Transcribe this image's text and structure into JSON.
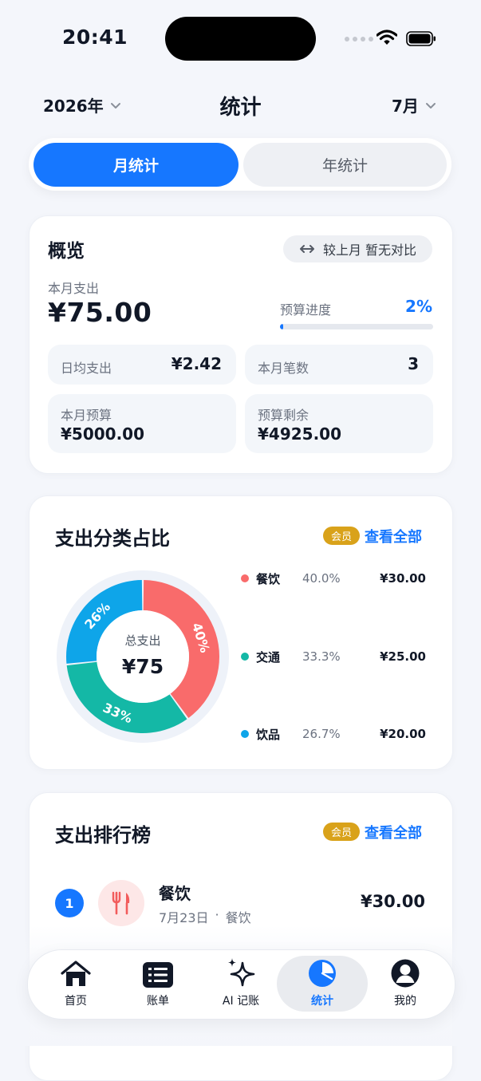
{
  "status": {
    "time": "20:41"
  },
  "header": {
    "year": "2026年",
    "title": "统计",
    "month": "7月"
  },
  "tabs": [
    {
      "label": "月统计",
      "active": true
    },
    {
      "label": "年统计",
      "active": false
    }
  ],
  "overview": {
    "title": "概览",
    "compare": "较上月 暂无对比",
    "month_spend_label": "本月支出",
    "month_spend": "¥75.00",
    "budget_progress_label": "预算进度",
    "budget_progress": "2%",
    "budget_progress_fraction": 0.02,
    "daily_avg_label": "日均支出",
    "daily_avg": "¥2.42",
    "count_label": "本月笔数",
    "count": "3",
    "budget_label": "本月预算",
    "budget": "¥5000.00",
    "remaining_label": "预算剩余",
    "remaining": "¥4925.00"
  },
  "category": {
    "title": "支出分类占比",
    "vip": "会员",
    "see_all": "查看全部",
    "center_label": "总支出",
    "center_value": "¥75",
    "items": [
      {
        "name": "餐饮",
        "pct": "40.0%",
        "amount": "¥30.00",
        "label": "40%",
        "color": "#f96b6b"
      },
      {
        "name": "交通",
        "pct": "33.3%",
        "amount": "¥25.00",
        "label": "33%",
        "color": "#14b8a6"
      },
      {
        "name": "饮品",
        "pct": "26.7%",
        "amount": "¥20.00",
        "label": "26%",
        "color": "#0ea5e9"
      }
    ]
  },
  "chart_data": {
    "type": "pie",
    "categories": [
      "餐饮",
      "交通",
      "饮品"
    ],
    "values": [
      30,
      25,
      20
    ],
    "colors": [
      "#f96b6b",
      "#14b8a6",
      "#0ea5e9"
    ]
  },
  "ranking": {
    "title": "支出排行榜",
    "vip": "会员",
    "see_all": "查看全部",
    "items": [
      {
        "rank": "1",
        "name": "餐饮",
        "date": "7月23日",
        "category": "餐饮",
        "amount": "¥30.00",
        "icon": "fork-knife-icon"
      }
    ]
  },
  "nav": [
    {
      "label": "首页",
      "icon": "home-icon"
    },
    {
      "label": "账单",
      "icon": "list-icon"
    },
    {
      "label": "AI 记账",
      "icon": "sparkle-icon"
    },
    {
      "label": "统计",
      "icon": "pie-chart-icon",
      "active": true
    },
    {
      "label": "我的",
      "icon": "user-icon"
    }
  ]
}
